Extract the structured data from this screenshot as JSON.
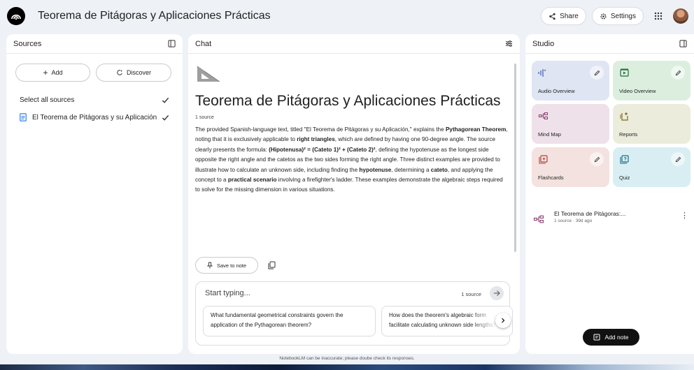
{
  "app": {
    "title": "Teorema de Pitágoras y Aplicaciones Prácticas"
  },
  "header": {
    "share_label": "Share",
    "settings_label": "Settings"
  },
  "sources": {
    "title": "Sources",
    "add_label": "Add",
    "discover_label": "Discover",
    "select_all_label": "Select all sources",
    "items": [
      {
        "label": "El Teorema de Pitágoras y su Aplicación",
        "checked": true
      }
    ]
  },
  "chat": {
    "title": "Chat",
    "heading": "Teorema de Pitágoras y Aplicaciones Prácticas",
    "meta": "1 source",
    "summary": {
      "s1": "The provided Spanish-language text, titled \"El Teorema de Pitágoras y su Aplicación,\" explains the ",
      "b1": "Pythagorean Theorem",
      "s2": ", noting that it is exclusively applicable to ",
      "b2": "right triangles",
      "s3": ", which are defined by having one 90-degree angle. The source clearly presents the formula: ",
      "b3": "(Hipotenusa)² = (Cateto 1)² + (Cateto 2)²",
      "s4": ", defining the hypotenuse as the longest side opposite the right angle and the catetos as the two sides forming the right angle. Three distinct examples are provided to illustrate how to calculate an unknown side, including finding the ",
      "b4": "hypotenuse",
      "s5": ", determining a ",
      "b5": "cateto",
      "s6": ", and applying the concept to a ",
      "b6": "practical scenario",
      "s7": " involving a firefighter's ladder. These examples demonstrate the algebraic steps required to solve for the missing dimension in various situations."
    },
    "save_note_label": "Save to note",
    "composer": {
      "placeholder": "Start typing...",
      "source_count": "1 source",
      "suggestions": [
        "What fundamental geometrical constraints govern the application of the Pythagorean theorem?",
        "How does the theorem's algebraic form facilitate calculating unknown side lengths?"
      ]
    }
  },
  "studio": {
    "title": "Studio",
    "tiles": [
      {
        "label": "Audio Overview"
      },
      {
        "label": "Video Overview"
      },
      {
        "label": "Mind Map"
      },
      {
        "label": "Reports"
      },
      {
        "label": "Flashcards"
      },
      {
        "label": "Quiz"
      }
    ],
    "note": {
      "title": "El Teorema de Pitágoras:...",
      "subtitle": "1 source · 39d ago"
    },
    "add_note_label": "Add note"
  },
  "footer": {
    "disclaimer": "NotebookLM can be inaccurate; please doube check its responses."
  },
  "colors": {
    "accent": "#1a73e8",
    "tile_audio": "#dfe5f3",
    "tile_video": "#dcefdf",
    "tile_mind": "#eee1e9",
    "tile_reports": "#ececdc",
    "tile_flash": "#f3e2df",
    "tile_quiz": "#d8eef3"
  }
}
